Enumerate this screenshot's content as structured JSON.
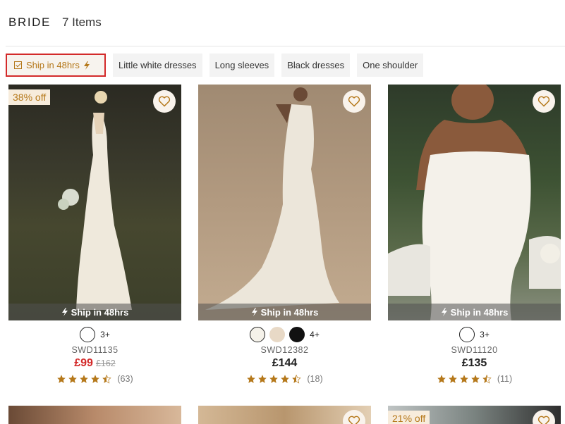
{
  "header": {
    "title": "BRIDE",
    "count": "7 Items"
  },
  "filters": [
    {
      "label": "Ship in 48hrs",
      "active": true
    },
    {
      "label": "Little white dresses"
    },
    {
      "label": "Long sleeves"
    },
    {
      "label": "Black dresses"
    },
    {
      "label": "One shoulder"
    }
  ],
  "ship_label": "Ship in 48hrs",
  "products": [
    {
      "badge": "38% off",
      "sku": "SWD11135",
      "price": "£99",
      "was": "£162",
      "more": "3+",
      "reviews": "(63)",
      "rating": 4.5,
      "swatches": [
        "#ffffff"
      ]
    },
    {
      "sku": "SWD12382",
      "price": "£144",
      "more": "4+",
      "reviews": "(18)",
      "rating": 4.5,
      "swatches": [
        "#f5f2ea",
        "#e8d9c6",
        "#111111"
      ]
    },
    {
      "sku": "SWD11120",
      "price": "£135",
      "more": "3+",
      "reviews": "(11)",
      "rating": 4.5,
      "swatches": [
        "#ffffff"
      ]
    }
  ],
  "row2": [
    {
      "badge": ""
    },
    {
      "badge": ""
    },
    {
      "badge": "21% off"
    }
  ],
  "colors": {
    "accent": "#b5781a",
    "sale": "#d32a2a",
    "highlight_border": "#d32a2a"
  }
}
